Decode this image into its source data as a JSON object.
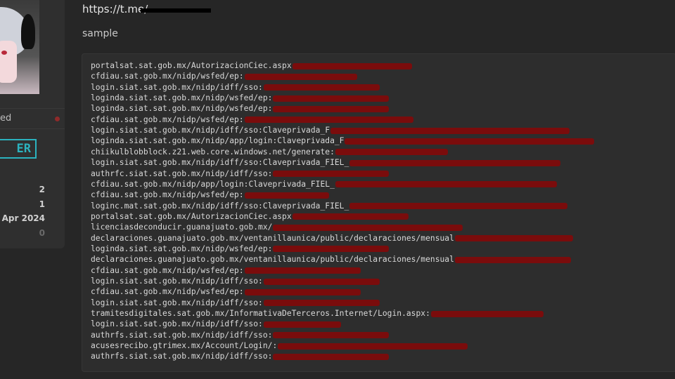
{
  "sidebar": {
    "status_text": "ed",
    "rank_badge": "ER",
    "stats": [
      "2",
      "1",
      "Apr 2024",
      "0"
    ]
  },
  "post": {
    "link_text": "https://t.me/",
    "caption": "sample",
    "code_lines": [
      {
        "text": "portalsat.sat.gob.mx/AutorizacionCiec.aspx",
        "redact": 170
      },
      {
        "text": "cfdiau.sat.gob.mx/nidp/wsfed/ep:",
        "redact": 160
      },
      {
        "text": "login.siat.sat.gob.mx/nidp/idff/sso:",
        "redact": 165
      },
      {
        "text": "loginda.siat.sat.gob.mx/nidp/wsfed/ep:",
        "redact": 165
      },
      {
        "text": "loginda.siat.sat.gob.mx/nidp/wsfed/ep:",
        "redact": 165
      },
      {
        "text": "cfdiau.sat.gob.mx/nidp/wsfed/ep:",
        "redact": 240
      },
      {
        "text": "login.siat.sat.gob.mx/nidp/idff/sso:Claveprivada_F",
        "redact": 340
      },
      {
        "text": "loginda.siat.sat.gob.mx/nidp/app/login:Claveprivada_F",
        "redact": 355
      },
      {
        "text": "chiikulblobblock.z21.web.core.windows.net/generate:",
        "redact": 160
      },
      {
        "text": "login.siat.sat.gob.mx/nidp/idff/sso:Claveprivada_FIEL_",
        "redact": 300
      },
      {
        "text": "authrfc.siat.sat.gob.mx/nidp/idff/sso:",
        "redact": 165
      },
      {
        "text": "cfdiau.sat.gob.mx/nidp/app/login:Claveprivada_FIEL_",
        "redact": 315
      },
      {
        "text": "cfdiau.sat.gob.mx/nidp/wsfed/ep:",
        "redact": 120
      },
      {
        "text": "loginc.mat.sat.gob.mx/nidp/idff/sso:Claveprivada_FIEL_",
        "redact": 310
      },
      {
        "text": "portalsat.sat.gob.mx/AutorizacionCiec.aspx",
        "redact": 165
      },
      {
        "text": "licenciasdeconducir.guanajuato.gob.mx/",
        "redact": 270
      },
      {
        "text": "declaraciones.guanajuato.gob.mx/ventanillaunica/public/declaraciones/mensual",
        "redact": 168
      },
      {
        "text": "loginda.siat.sat.gob.mx/nidp/wsfed/ep:",
        "redact": 165
      },
      {
        "text": "declaraciones.guanajuato.gob.mx/ventanillaunica/public/declaraciones/mensual",
        "redact": 165
      },
      {
        "text": "cfdiau.sat.gob.mx/nidp/wsfed/ep:",
        "redact": 165
      },
      {
        "text": "login.siat.sat.gob.mx/nidp/idff/sso:",
        "redact": 165
      },
      {
        "text": "cfdiau.sat.gob.mx/nidp/wsfed/ep:",
        "redact": 165
      },
      {
        "text": "login.siat.sat.gob.mx/nidp/idff/sso:",
        "redact": 165
      },
      {
        "text": "tramitesdigitales.sat.gob.mx/InformativaDeTerceros.Internet/Login.aspx:",
        "redact": 160
      },
      {
        "text": "login.siat.sat.gob.mx/nidp/idff/sso:",
        "redact": 110
      },
      {
        "text": "authrfs.siat.sat.gob.mx/nidp/idff/sso:",
        "redact": 165
      },
      {
        "text": "acusesrecibo.gtrimex.mx/Account/Login/:",
        "redact": 270
      },
      {
        "text": "authrfs.siat.sat.gob.mx/nidp/idff/sso:",
        "redact": 165
      }
    ]
  },
  "colors": {
    "background": "#262626",
    "codebox": "#2d2d2d",
    "redaction": "#7a0c0c",
    "rank_badge": "#2bb3bf",
    "status_dot": "#8f2a2a"
  }
}
